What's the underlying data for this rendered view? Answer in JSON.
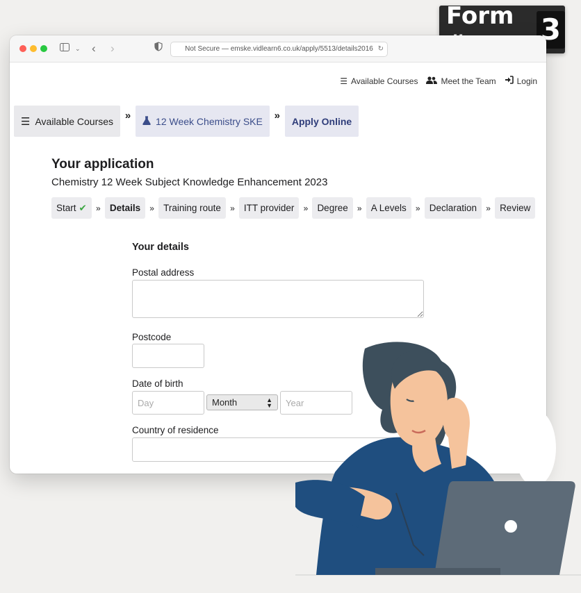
{
  "badge": {
    "text": "Form #",
    "number": "3"
  },
  "browser": {
    "url": "Not Secure — emske.vidlearn6.co.uk/apply/5513/details2016"
  },
  "topnav": [
    {
      "label": "Available Courses",
      "icon": "list-icon"
    },
    {
      "label": "Meet the Team",
      "icon": "users-icon"
    },
    {
      "label": "Login",
      "icon": "login-icon"
    }
  ],
  "breadcrumbs": [
    {
      "label": "Available Courses",
      "icon": "list-icon"
    },
    {
      "label": "12 Week Chemistry SKE",
      "icon": "flask-icon"
    },
    {
      "label": "Apply Online"
    }
  ],
  "application": {
    "title": "Your application",
    "subtitle": "Chemistry 12 Week Subject Knowledge Enhancement 2023"
  },
  "steps": [
    "Start",
    "Details",
    "Training route",
    "ITT provider",
    "Degree",
    "A Levels",
    "Declaration",
    "Review"
  ],
  "form": {
    "section_title": "Your details",
    "postal_address_label": "Postal address",
    "postal_address_value": "",
    "postcode_label": "Postcode",
    "postcode_value": "",
    "dob_label": "Date of birth",
    "day_placeholder": "Day",
    "month_selected": "Month",
    "year_placeholder": "Year",
    "country_label": "Country of residence",
    "country_value": ""
  },
  "colors": {
    "accent": "#3b4d8a",
    "check": "#3aa640",
    "shirt": "#1f4e7f",
    "laptop": "#5d6b78"
  }
}
